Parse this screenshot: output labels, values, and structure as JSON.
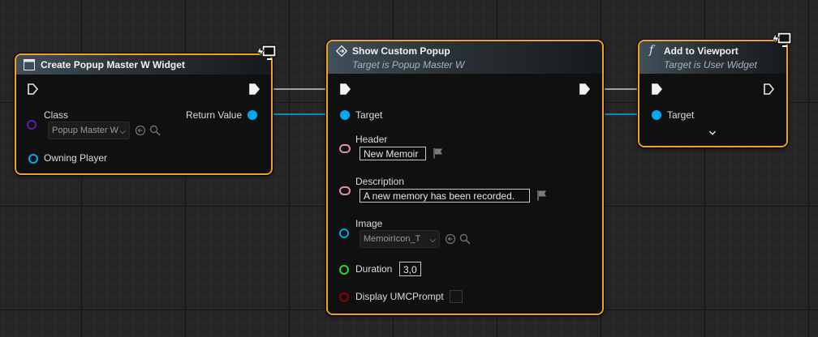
{
  "nodes": {
    "create_widget": {
      "title": "Create Popup Master W Widget",
      "return_value_label": "Return Value",
      "class_label": "Class",
      "class_value": "Popup Master W",
      "owning_player_label": "Owning Player"
    },
    "show_popup": {
      "title": "Show Custom Popup",
      "subtitle": "Target is Popup Master W",
      "target_label": "Target",
      "header_label": "Header",
      "header_value": "New Memoir",
      "description_label": "Description",
      "description_value": "A new memory has been recorded.",
      "image_label": "Image",
      "image_value": "MemoirIcon_T",
      "duration_label": "Duration",
      "duration_value": "3,0",
      "display_prompt_label": "Display UMCPrompt"
    },
    "add_to_viewport": {
      "title": "Add to Viewport",
      "subtitle": "Target is User Widget",
      "target_label": "Target"
    }
  },
  "icons": {
    "function": "function-f-icon",
    "event": "event-diamond-icon",
    "class": "class-widget-icon",
    "latent": "latent-monitor-icon",
    "exec": "exec-arrow-icon",
    "browse": "browse-arrow-icon",
    "search": "search-icon",
    "flag": "flag-icon",
    "expand": "chevron-down-icon"
  },
  "colors": {
    "node_border": "#f3a21a",
    "object_pin": "#00a8f0",
    "class_pin": "#5a1fa3",
    "text_pin": "#e58ab0",
    "float_pin": "#2fd22f",
    "bool_pin": "#8c0000",
    "exec_wire": "#c8c8c8"
  }
}
